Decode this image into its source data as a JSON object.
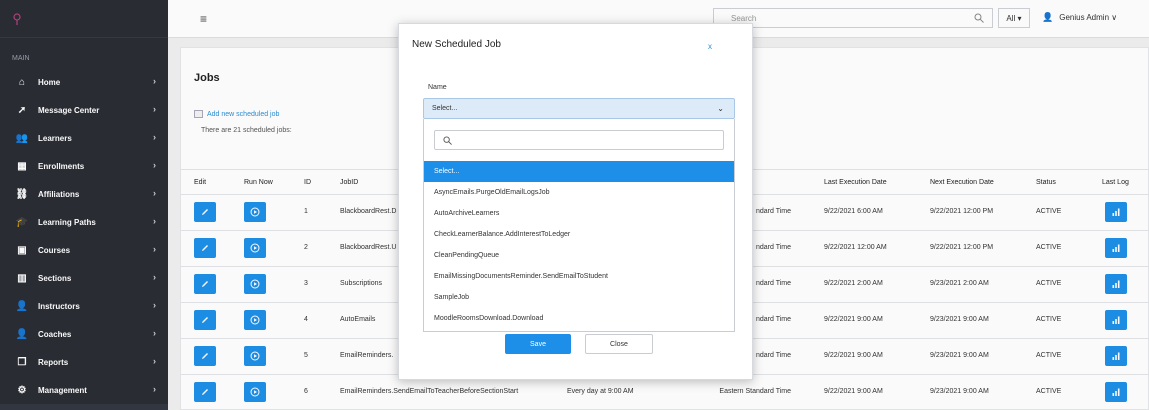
{
  "sidebar": {
    "section_label": "MAIN",
    "items": [
      {
        "label": "Home",
        "icon": "home-icon",
        "glyph": "⌂"
      },
      {
        "label": "Message Center",
        "icon": "send-icon",
        "glyph": "➚"
      },
      {
        "label": "Learners",
        "icon": "users-icon",
        "glyph": "👥"
      },
      {
        "label": "Enrollments",
        "icon": "calendar-icon",
        "glyph": "▦"
      },
      {
        "label": "Affiliations",
        "icon": "sitemap-icon",
        "glyph": "⛓"
      },
      {
        "label": "Learning Paths",
        "icon": "graduation-cap-icon",
        "glyph": "🎓"
      },
      {
        "label": "Courses",
        "icon": "save-icon",
        "glyph": "▣"
      },
      {
        "label": "Sections",
        "icon": "books-icon",
        "glyph": "▥"
      },
      {
        "label": "Instructors",
        "icon": "user-tie-icon",
        "glyph": "👤"
      },
      {
        "label": "Coaches",
        "icon": "user-tie-icon",
        "glyph": "👤"
      },
      {
        "label": "Reports",
        "icon": "copy-icon",
        "glyph": "❐"
      },
      {
        "label": "Management",
        "icon": "gear-icon",
        "glyph": "⚙"
      }
    ]
  },
  "topbar": {
    "search_placeholder": "Search",
    "scope": "All ▾",
    "user_name": "Genius Admin ∨"
  },
  "main": {
    "title": "Jobs",
    "add_link": "Add new scheduled job",
    "count_text": "There are 21 scheduled jobs:",
    "columns": {
      "edit": "Edit",
      "run": "Run Now",
      "id": "ID",
      "job": "JobID",
      "last_exec": "Last Execution Date",
      "next_exec": "Next Execution Date",
      "status": "Status",
      "last_log": "Last Log"
    },
    "rows": [
      {
        "id": "1",
        "job": "BlackboardRest.D",
        "schedule": "",
        "tz": "ndard Time",
        "last": "9/22/2021 6:00 AM",
        "next": "9/22/2021 12:00 PM",
        "status": "ACTIVE"
      },
      {
        "id": "2",
        "job": "BlackboardRest.U",
        "schedule": "",
        "tz": "ndard Time",
        "last": "9/22/2021 12:00 AM",
        "next": "9/22/2021 12:00 PM",
        "status": "ACTIVE"
      },
      {
        "id": "3",
        "job": "Subscriptions",
        "schedule": "",
        "tz": "ndard Time",
        "last": "9/22/2021 2:00 AM",
        "next": "9/23/2021 2:00 AM",
        "status": "ACTIVE"
      },
      {
        "id": "4",
        "job": "AutoEmails",
        "schedule": "",
        "tz": "ndard Time",
        "last": "9/22/2021 9:00 AM",
        "next": "9/23/2021 9:00 AM",
        "status": "ACTIVE"
      },
      {
        "id": "5",
        "job": "EmailReminders.",
        "schedule": "",
        "tz": "ndard Time",
        "last": "9/22/2021 9:00 AM",
        "next": "9/23/2021 9:00 AM",
        "status": "ACTIVE"
      },
      {
        "id": "6",
        "job": "EmailReminders.SendEmailToTeacherBeforeSectionStart",
        "schedule": "Every day at 9:00 AM",
        "tz": "Eastern Standard Time",
        "last": "9/22/2021 9:00 AM",
        "next": "9/23/2021 9:00 AM",
        "status": "ACTIVE"
      }
    ]
  },
  "modal": {
    "title": "New Scheduled Job",
    "close_x": "x",
    "name_label": "Name",
    "selected_value": "Select...",
    "options": [
      "Select...",
      "AsyncEmails.PurgeOldEmailLogsJob",
      "AutoArchiveLearners",
      "CheckLearnerBalance.AddInterestToLedger",
      "CleanPendingQueue",
      "EmailMissingDocumentsReminder.SendEmailToStudent",
      "SampleJob",
      "MoodleRoomsDownload.Download"
    ],
    "save_label": "Save",
    "close_label": "Close"
  },
  "colors": {
    "sidebar_bg": "#2a2d35",
    "accent": "#1e8fe8",
    "select_bg": "#dcebf7"
  }
}
